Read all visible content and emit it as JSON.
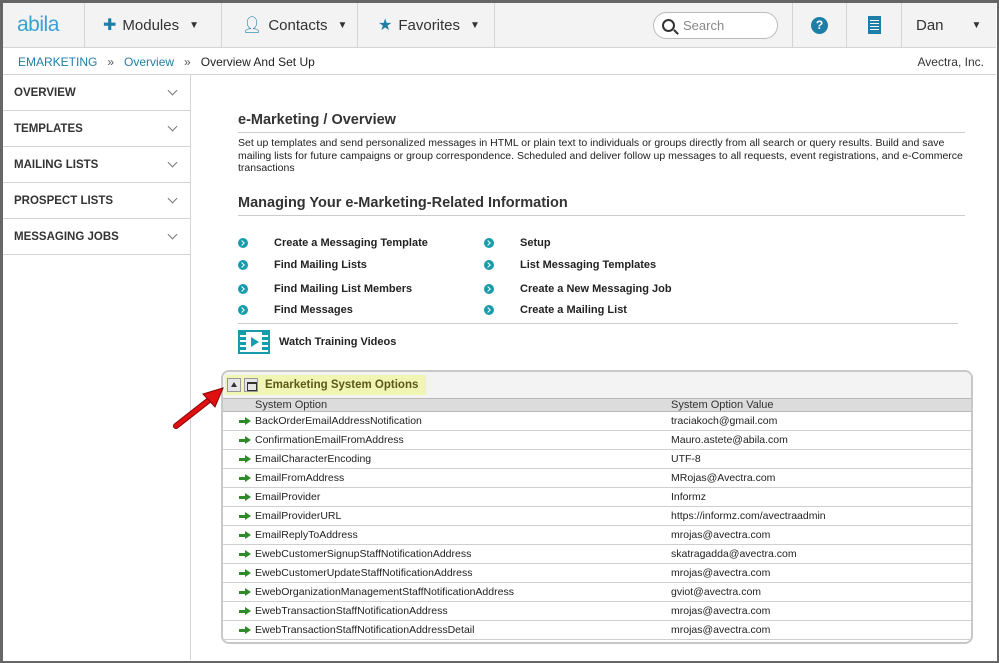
{
  "nav": {
    "logo": "abila",
    "modules": "Modules",
    "contacts": "Contacts",
    "favorites": "Favorites",
    "search_placeholder": "Search",
    "help": "?",
    "user": "Dan"
  },
  "breadcrumb": {
    "items": [
      "EMARKETING",
      "Overview",
      "Overview And Set Up"
    ],
    "separator": "»",
    "org": "Avectra, Inc."
  },
  "sidebar": {
    "items": [
      {
        "label": "OVERVIEW"
      },
      {
        "label": "TEMPLATES"
      },
      {
        "label": "MAILING LISTS"
      },
      {
        "label": "PROSPECT LISTS"
      },
      {
        "label": "MESSAGING JOBS"
      }
    ]
  },
  "main": {
    "title": "e-Marketing / Overview",
    "description": "Set up templates and send personalized messages in HTML or plain text to individuals or groups directly from all search or query results. Build and save mailing lists for future campaigns or group correspondence. Scheduled and deliver follow up messages to all requests, event registrations, and e-Commerce transactions",
    "subtitle": "Managing Your e-Marketing-Related Information",
    "links_left": [
      "Create a Messaging Template",
      "Find Mailing Lists",
      "Find Mailing List Members",
      "Find Messages"
    ],
    "links_right": [
      "Setup",
      "List Messaging Templates",
      "Create a New Messaging Job",
      "Create a Mailing List"
    ],
    "video_label": "Watch Training Videos"
  },
  "panel": {
    "title": "Emarketing System Options",
    "columns": [
      "System Option",
      "System Option Value"
    ],
    "rows": [
      {
        "option": "BackOrderEmailAddressNotification",
        "value": "traciakoch@gmail.com"
      },
      {
        "option": "ConfirmationEmailFromAddress",
        "value": "Mauro.astete@abila.com"
      },
      {
        "option": "EmailCharacterEncoding",
        "value": "UTF-8"
      },
      {
        "option": "EmailFromAddress",
        "value": "MRojas@Avectra.com"
      },
      {
        "option": "EmailProvider",
        "value": "Informz"
      },
      {
        "option": "EmailProviderURL",
        "value": "https://informz.com/avectraadmin"
      },
      {
        "option": "EmailReplyToAddress",
        "value": "mrojas@avectra.com"
      },
      {
        "option": "EwebCustomerSignupStaffNotificationAddress",
        "value": "skatragadda@avectra.com"
      },
      {
        "option": "EwebCustomerUpdateStaffNotificationAddress",
        "value": "mrojas@avectra.com"
      },
      {
        "option": "EwebOrganizationManagementStaffNotificationAddress",
        "value": "gviot@avectra.com"
      },
      {
        "option": "EwebTransactionStaffNotificationAddress",
        "value": "mrojas@avectra.com"
      },
      {
        "option": "EwebTransactionStaffNotificationAddressDetail",
        "value": "mrojas@avectra.com"
      }
    ]
  },
  "colors": {
    "brand": "#3aa0d5",
    "link": "#1f7ea8",
    "teal_bullet": "#179cab",
    "panel_highlight": "#f1f5b4",
    "row_arrow": "#2f8a2a",
    "annotation_arrow": "#e01010"
  },
  "icons": {
    "modules": "puzzle-icon",
    "contacts": "person-icon",
    "favorites": "star-icon",
    "search": "search-icon",
    "help": "help-icon",
    "organization": "building-icon",
    "video": "film-icon",
    "row": "green-arrow-icon"
  }
}
